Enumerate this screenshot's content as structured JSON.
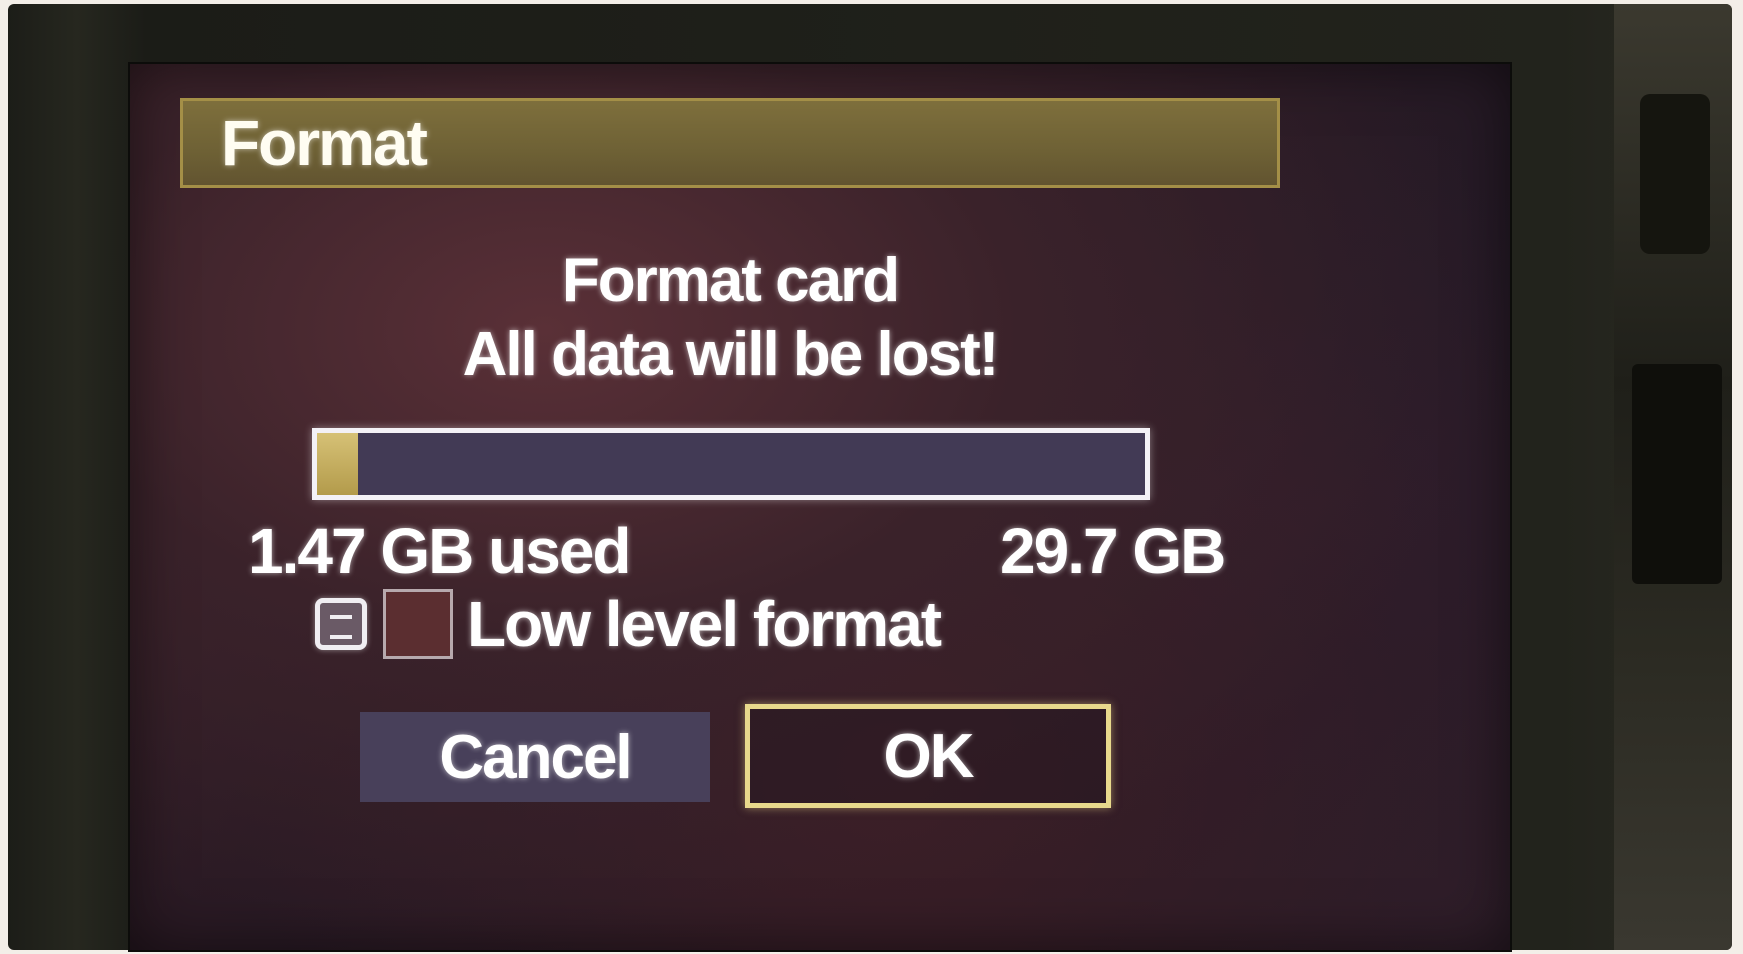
{
  "dialog": {
    "title": "Format",
    "message_line1": "Format card",
    "message_line2": "All data will be lost!"
  },
  "storage": {
    "used_label": "1.47 GB used",
    "total_label": "29.7 GB",
    "used_fraction": 0.05
  },
  "option": {
    "icon": "menu-icon",
    "checkbox_checked": false,
    "label": "Low level format"
  },
  "buttons": {
    "cancel_label": "Cancel",
    "ok_label": "OK",
    "selected": "OK"
  },
  "colors": {
    "title_bar": "#6e6135",
    "title_border": "#a48f47",
    "progress_fill": "#c4ad5f",
    "progress_track": "#423a55",
    "cancel_bg": "#48405a",
    "ok_border": "#e8d98c"
  }
}
